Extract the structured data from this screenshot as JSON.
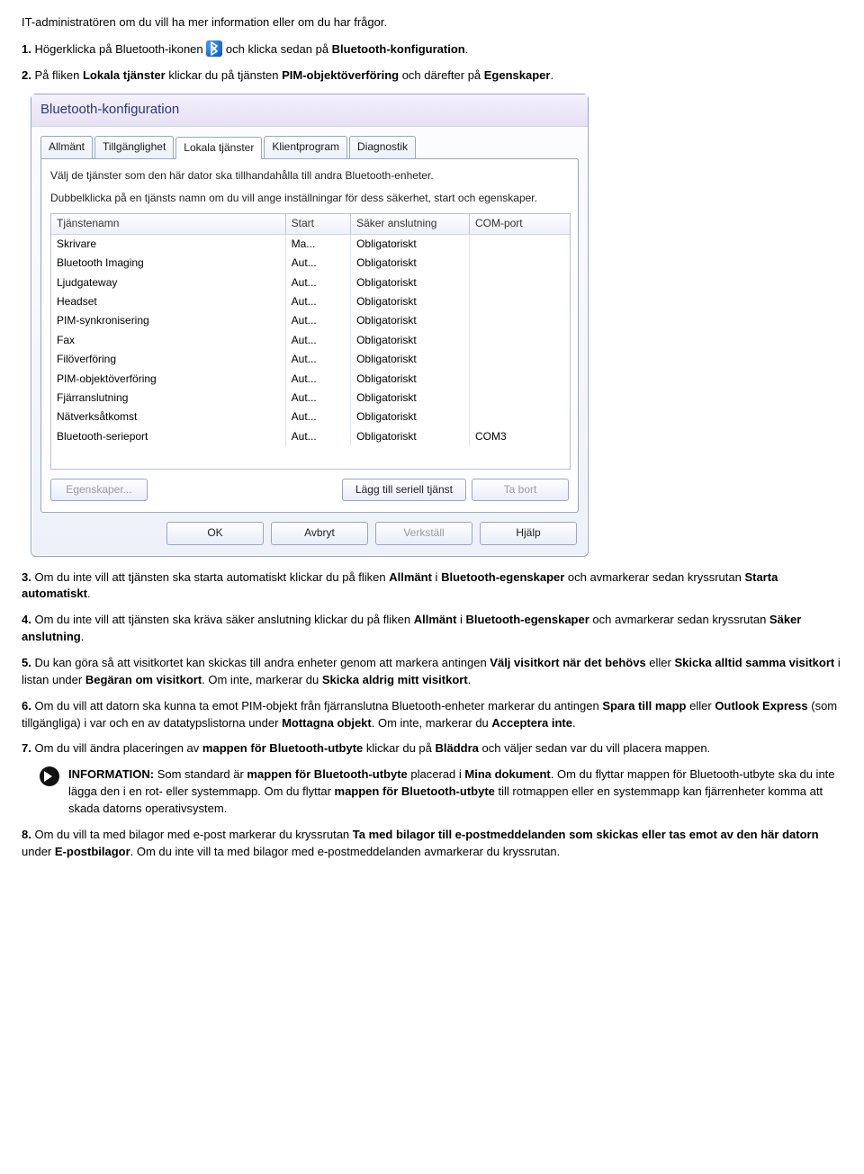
{
  "intro": "IT-administratören om du vill ha mer information eller om du har frågor.",
  "steps": {
    "s1_a": "Högerklicka på Bluetooth-ikonen ",
    "s1_b": " och klicka sedan på ",
    "s1_bold": "Bluetooth-konfiguration",
    "s2_a": "På fliken ",
    "s2_b1": "Lokala tjänster",
    "s2_c": " klickar du på tjänsten ",
    "s2_b2": "PIM-objektöverföring",
    "s2_d": " och därefter på ",
    "s2_b3": "Egenskaper",
    "s3_a": "Om du inte vill att tjänsten ska starta automatiskt klickar du på fliken ",
    "s3_b1": "Allmänt",
    "s3_b": " i ",
    "s3_b2": "Bluetooth-egenskaper",
    "s3_c": " och avmarkerar sedan kryssrutan ",
    "s3_b3": "Starta automatiskt",
    "s4_a": "Om du inte vill att tjänsten ska kräva säker anslutning klickar du på fliken ",
    "s4_b1": "Allmänt",
    "s4_b": " i ",
    "s4_b2": "Bluetooth-egenskaper",
    "s4_c": " och avmarkerar sedan kryssrutan ",
    "s4_b3": "Säker anslutning",
    "s5_a": "Du kan göra så att visitkortet kan skickas till andra enheter genom att markera antingen ",
    "s5_b1": "Välj visitkort när det behövs",
    "s5_b": " eller ",
    "s5_b2": "Skicka alltid samma visitkort",
    "s5_c": " i listan under ",
    "s5_b3": "Begäran om visitkort",
    "s5_d": ". Om inte, markerar du ",
    "s5_b4": "Skicka aldrig mitt visitkort",
    "s6_a": "Om du vill att datorn ska kunna ta emot PIM-objekt från fjärranslutna Bluetooth-enheter markerar du antingen ",
    "s6_b1": "Spara till mapp",
    "s6_b": " eller ",
    "s6_b2": "Outlook Express",
    "s6_c": " (som tillgängliga) i var och en av datatypslistorna under ",
    "s6_b3": "Mottagna objekt",
    "s6_d": ". Om inte, markerar du ",
    "s6_b4": "Acceptera inte",
    "s7_a": "Om du vill ändra placeringen av ",
    "s7_b1": "mappen för Bluetooth-utbyte",
    "s7_b": " klickar du på ",
    "s7_b2": "Bläddra",
    "s7_c": " och väljer sedan var du vill placera mappen.",
    "s8_a": "Om du vill ta med bilagor med e-post markerar du kryssrutan ",
    "s8_b1": "Ta med bilagor till e-postmeddelanden som skickas eller tas emot av den här datorn",
    "s8_b": " under ",
    "s8_b2": "E-postbilagor",
    "s8_c": ". Om du inte vill ta med bilagor med e-postmeddelanden avmarkerar du kryssrutan."
  },
  "info": {
    "label": "INFORMATION:",
    "a": " Som standard är ",
    "b1": "mappen för Bluetooth-utbyte",
    "b": " placerad i ",
    "b2": "Mina dokument",
    "c": ". Om du flyttar mappen för Bluetooth-utbyte ska du inte lägga den i en rot- eller systemmapp. Om du flyttar ",
    "b3": "mappen för Bluetooth-utbyte",
    "d": " till rotmappen eller en systemmapp kan fjärrenheter komma att skada datorns operativsystem."
  },
  "dlg": {
    "title": "Bluetooth-konfiguration",
    "tabs": [
      "Allmänt",
      "Tillgänglighet",
      "Lokala tjänster",
      "Klientprogram",
      "Diagnostik"
    ],
    "desc1": "Välj de tjänster som den här dator ska tillhandahålla till andra Bluetooth-enheter.",
    "desc2": "Dubbelklicka på en tjänsts namn om du vill ange inställningar för dess säkerhet, start och egenskaper.",
    "cols": [
      "Tjänstenamn",
      "Start",
      "Säker anslutning",
      "COM-port"
    ],
    "rows": [
      {
        "name": "Skrivare",
        "start": "Ma...",
        "sec": "Obligatoriskt",
        "com": ""
      },
      {
        "name": "Bluetooth Imaging",
        "start": "Aut...",
        "sec": "Obligatoriskt",
        "com": ""
      },
      {
        "name": "Ljudgateway",
        "start": "Aut...",
        "sec": "Obligatoriskt",
        "com": ""
      },
      {
        "name": "Headset",
        "start": "Aut...",
        "sec": "Obligatoriskt",
        "com": ""
      },
      {
        "name": "PIM-synkronisering",
        "start": "Aut...",
        "sec": "Obligatoriskt",
        "com": ""
      },
      {
        "name": "Fax",
        "start": "Aut...",
        "sec": "Obligatoriskt",
        "com": ""
      },
      {
        "name": "Filöverföring",
        "start": "Aut...",
        "sec": "Obligatoriskt",
        "com": ""
      },
      {
        "name": "PIM-objektöverföring",
        "start": "Aut...",
        "sec": "Obligatoriskt",
        "com": ""
      },
      {
        "name": "Fjärranslutning",
        "start": "Aut...",
        "sec": "Obligatoriskt",
        "com": ""
      },
      {
        "name": "Nätverksåtkomst",
        "start": "Aut...",
        "sec": "Obligatoriskt",
        "com": ""
      },
      {
        "name": "Bluetooth-serieport",
        "start": "Aut...",
        "sec": "Obligatoriskt",
        "com": "COM3"
      }
    ],
    "btnProps": "Egenskaper...",
    "btnAddSerial": "Lägg till seriell tjänst",
    "btnDelete": "Ta bort",
    "btnOK": "OK",
    "btnCancel": "Avbryt",
    "btnApply": "Verkställ",
    "btnHelp": "Hjälp"
  }
}
